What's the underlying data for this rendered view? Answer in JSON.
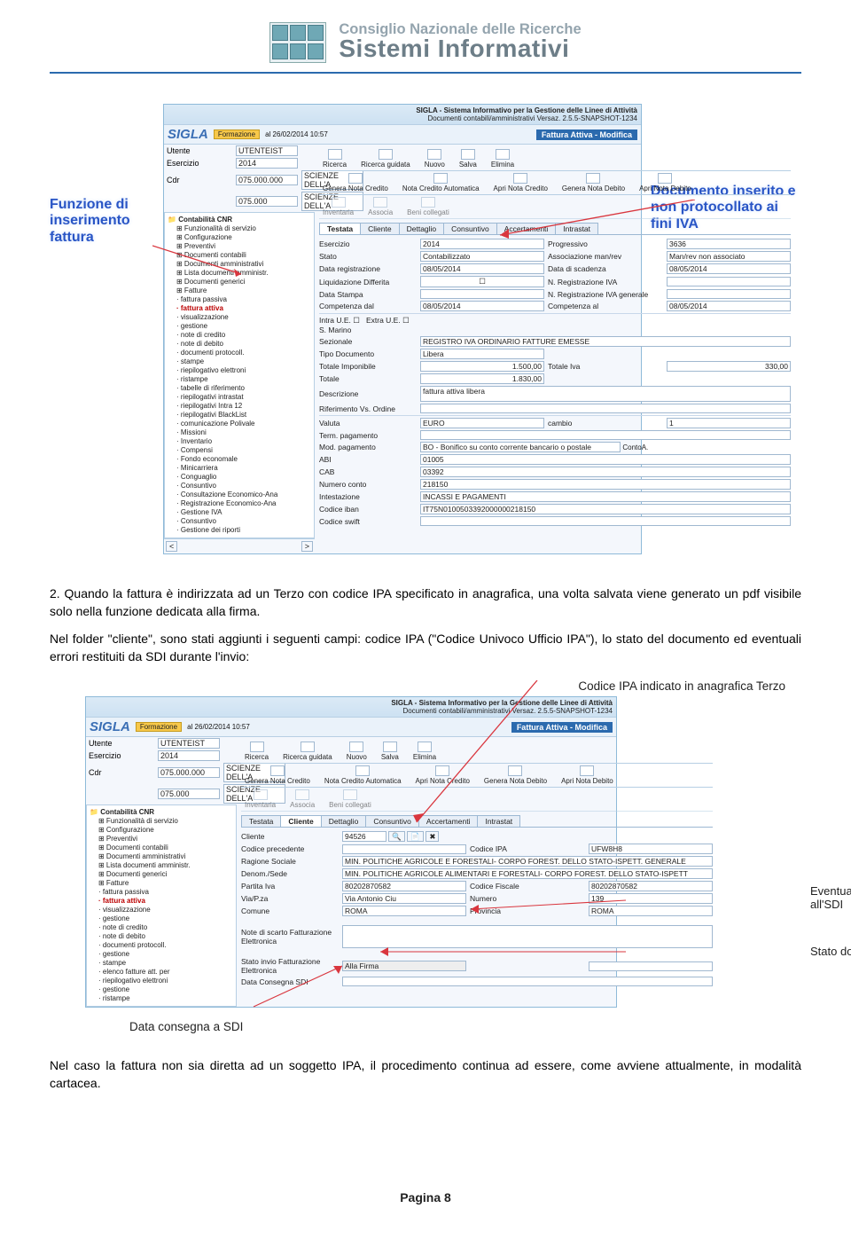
{
  "header": {
    "sup": "Consiglio Nazionale delle Ricerche",
    "main": "Sistemi Informativi"
  },
  "callouts": {
    "left": "Funzione di inserimento fattura",
    "right": "Documento inserito e non protocollato ai fini IVA"
  },
  "app": {
    "titlebar": "SIGLA - Sistema Informativo per la Gestione delle Linee di Attività",
    "subtitlebar": "Documenti contabili/amministrativi Versaz. 2.5.5-SNAPSHOT-1234",
    "logo": "SIGLA",
    "env": "Formazione",
    "datestamp": "al 26/02/2014 10:57",
    "top": {
      "utente_label": "Utente",
      "utente_value": "UTENTEIST",
      "esercizio_label": "Esercizio",
      "esercizio_value": "2014",
      "cdr_label": "Cdr",
      "cdr_value": "075.000.000",
      "cdr_text": "SCIENZE DELL'A",
      "cds_value": "075.000",
      "cds_text": "SCIENZE DELL'A"
    },
    "window_title": "Fattura Attiva - Modifica",
    "toolbar": {
      "ricerca": "Ricerca",
      "ricerca_guidata": "Ricerca guidata",
      "nuovo": "Nuovo",
      "salva": "Salva",
      "elimina": "Elimina",
      "genera_nota_credito": "Genera Nota Credito",
      "nota_credito_auto": "Nota Credito Automatica",
      "apri_nota_credito": "Apri Nota Credito",
      "genera_nota_debito": "Genera Nota Debito",
      "apri_nota_debito": "Apri Nota Debito",
      "inventaria": "Inventaria",
      "associa": "Associa",
      "beni_collegati": "Beni collegati"
    },
    "tabs": {
      "testata": "Testata",
      "cliente": "Cliente",
      "dettaglio": "Dettaglio",
      "consuntivo": "Consuntivo",
      "accertamenti": "Accertamenti",
      "intrastat": "Intrastat"
    },
    "form1": {
      "esercizio_l": "Esercizio",
      "esercizio_v": "2014",
      "progressivo_l": "Progressivo",
      "progressivo_v": "3636",
      "stato_l": "Stato",
      "stato_v": "Contabilizzato",
      "assoc_l": "Associazione man/rev",
      "assoc_v": "Man/rev non associato",
      "data_reg_l": "Data registrazione",
      "data_reg_v": "08/05/2014",
      "data_scad_l": "Data di scadenza",
      "data_scad_v": "08/05/2014",
      "liq_l": "Liquidazione Differita",
      "liq_v": "☐",
      "n_reg_iva_l": "N. Registrazione IVA",
      "n_reg_iva_v": "",
      "data_stampa_l": "Data Stampa",
      "data_stampa_v": "",
      "n_reg_gen_l": "N. Registrazione IVA generale",
      "n_reg_gen_v": "",
      "comp_dal_l": "Competenza dal",
      "comp_dal_v": "08/05/2014",
      "comp_al_l": "Competenza al",
      "comp_al_v": "08/05/2014",
      "intra_ue": "Intra U.E.",
      "extra_ue": "Extra U.E.",
      "smarino": "S. Marino",
      "sezionale_l": "Sezionale",
      "sezionale_v": "REGISTRO IVA ORDINARIO FATTURE EMESSE",
      "tipo_doc_l": "Tipo Documento",
      "tipo_doc_v": "Libera",
      "tot_imp_l": "Totale Imponibile",
      "tot_imp_v": "1.500,00",
      "tot_iva_l": "Totale Iva",
      "tot_iva_v": "330,00",
      "totale_l": "Totale",
      "totale_v": "1.830,00",
      "descr_l": "Descrizione",
      "descr_v": "fattura attiva libera",
      "rif_ordine_l": "Riferimento Vs. Ordine",
      "rif_ordine_v": "",
      "valuta_l": "Valuta",
      "valuta_v": "EURO",
      "cambio_l": "cambio",
      "cambio_v": "1",
      "term_pag_l": "Term. pagamento",
      "term_pag_v": "",
      "mod_pag_l": "Mod. pagamento",
      "mod_pag_v": "BO - Bonifico su conto corrente bancario o postale",
      "abi_l": "ABI",
      "abi_v": "01005",
      "cab_l": "CAB",
      "cab_v": "03392",
      "numconto_l": "Numero conto",
      "numconto_v": "218150",
      "intest_l": "Intestazione",
      "intest_v": "INCASSI E PAGAMENTI",
      "iban_l": "Codice iban",
      "iban_v": "IT75N0100503392000000218150",
      "swift_l": "Codice swift",
      "swift_v": "",
      "conti_l": "ContoA."
    },
    "tree": {
      "root": "Contabilità CNR",
      "items": [
        "Funzionalità di servizio",
        "Configurazione",
        "Preventivi",
        "Documenti contabili",
        "Documenti amministrativi",
        "Lista documenti amministr.",
        "Documenti generici",
        "Fatture",
        "fattura passiva",
        "fattura attiva",
        "visualizzazione",
        "gestione",
        "note di credito",
        "note di debito",
        "documenti protocoll.",
        "stampe",
        "riepilogativo elettroni",
        "ristampe",
        "tabelle di riferimento",
        "riepilogativi intrastat",
        "riepilogativi Intra 12",
        "riepilogativi BlackList",
        "comunicazione Polivale",
        "Missioni",
        "Inventario",
        "Compensi",
        "Fondo economale",
        "Minicarriera",
        "Conguaglio",
        "Consuntivo",
        "Consultazione Economico-Ana",
        "Registrazione Economico-Ana",
        "Gestione IVA",
        "Consuntivo",
        "Gestione dei riporti"
      ],
      "items2": [
        "Funzionalità di servizio",
        "Configurazione",
        "Preventivi",
        "Documenti contabili",
        "Documenti amministrativi",
        "Lista documenti amministr.",
        "Documenti generici",
        "Fatture",
        "fattura passiva",
        "fattura attiva",
        "visualizzazione",
        "gestione",
        "note di credito",
        "note di debito",
        "documenti protocoll.",
        "gestione",
        "stampe",
        "elenco fatture att. per",
        "riepilogativo elettroni",
        "gestione",
        "ristampe"
      ]
    },
    "form2": {
      "cliente_l": "Cliente",
      "cliente_v": "94526",
      "cod_prec_l": "Codice precedente",
      "cod_prec_v": "",
      "cod_ipa_l": "Codice IPA",
      "cod_ipa_v": "UFW8H8",
      "rag_soc_l": "Ragione Sociale",
      "rag_soc_v": "MIN. POLITICHE AGRICOLE E FORESTALI- CORPO FOREST. DELLO STATO-ISPETT. GENERALE",
      "denom_l": "Denom./Sede",
      "denom_v": "MIN. POLITICHE AGRICOLE ALIMENTARI E FORESTALI- CORPO FOREST. DELLO STATO-ISPETT",
      "piva_l": "Partita Iva",
      "piva_v": "80202870582",
      "cf_l": "Codice Fiscale",
      "cf_v": "80202870582",
      "via_l": "Via/P.za",
      "via_v": "Via Antonio Ciu",
      "num_l": "Numero",
      "num_v": "139",
      "comune_l": "Comune",
      "comune_v": "ROMA",
      "prov_l": "Provincia",
      "prov_v": "ROMA",
      "note_scarto_l": "Note di scarto Fatturazione Elettronica",
      "note_scarto_v": "",
      "stato_invio_l": "Stato invio Fatturazione Elettronica",
      "stato_invio_v": "Alla Firma",
      "data_consegna_l": "Data Consegna SDI",
      "data_consegna_v": ""
    }
  },
  "body": {
    "p1": "2. Quando la fattura è indirizzata ad un Terzo con codice IPA specificato in anagrafica, una volta salvata viene generato un pdf visibile solo nella funzione dedicata alla firma.",
    "p2_a": "Nel folder \"cliente\", sono stati aggiunti i seguenti campi: codice IPA (\"Codice Univoco Ufficio IPA\"), lo stato del documento ed eventuali errori restituiti da SDI durante l'invio:",
    "anno_ipa": "Codice IPA indicato in anagrafica Terzo",
    "anno_err": "Eventuali errori di trasmissione all'SDI",
    "anno_stato": "Stato documento",
    "anno_data": "Data consegna a SDI",
    "p3": "Nel caso la fattura non sia diretta ad un soggetto IPA, il procedimento continua ad essere, come avviene attualmente, in modalità cartacea."
  },
  "footer": {
    "page": "Pagina 8"
  }
}
